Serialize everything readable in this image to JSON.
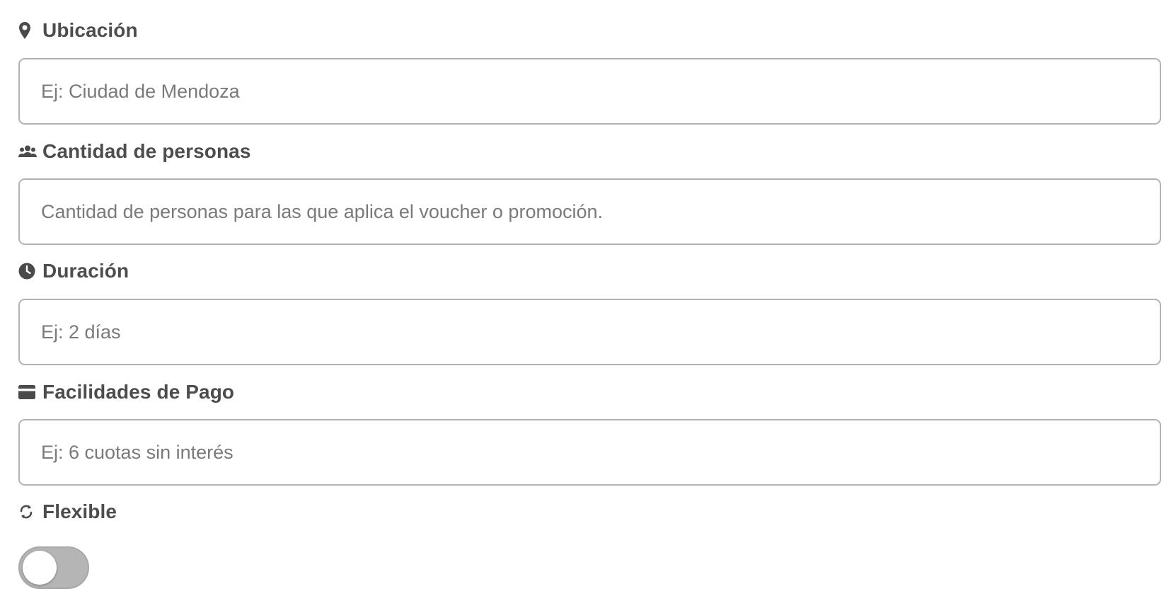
{
  "fields": [
    {
      "label": "Ubicación",
      "icon": "location-pin-icon",
      "placeholder": "Ej: Ciudad de Mendoza",
      "value": ""
    },
    {
      "label": "Cantidad de personas",
      "icon": "people-icon",
      "placeholder": "Cantidad de personas para las que aplica el voucher o promoción.",
      "value": ""
    },
    {
      "label": "Duración",
      "icon": "clock-icon",
      "placeholder": "Ej: 2 días",
      "value": ""
    },
    {
      "label": "Facilidades de Pago",
      "icon": "credit-card-icon",
      "placeholder": "Ej: 6 cuotas sin interés",
      "value": ""
    }
  ],
  "flexible": {
    "label": "Flexible",
    "icon": "sync-icon",
    "enabled": false
  },
  "colors": {
    "label_text": "#4d4d4d",
    "input_border": "#b3b3b3",
    "placeholder": "#7a7a7a",
    "toggle_off": "#b5b5b5"
  }
}
